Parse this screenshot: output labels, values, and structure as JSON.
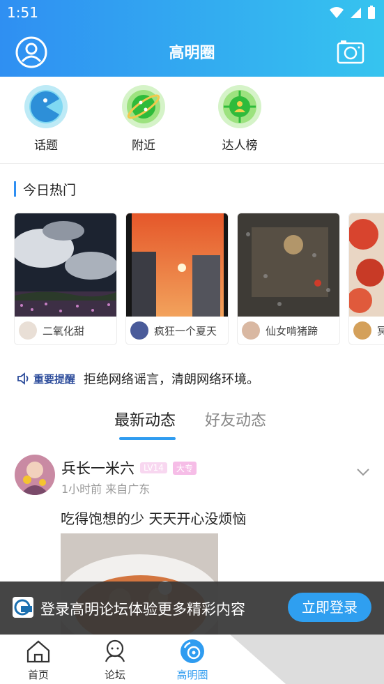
{
  "status_bar": {
    "time": "1:51"
  },
  "header": {
    "title": "高明圈",
    "profile_icon": "user-circle-icon",
    "camera_icon": "camera-icon"
  },
  "quick_entries": [
    {
      "label": "话题",
      "icon": "topic-icon",
      "color": "#7fd8f2"
    },
    {
      "label": "附近",
      "icon": "planet-icon",
      "color": "#9de27f"
    },
    {
      "label": "达人榜",
      "icon": "target-user-icon",
      "color": "#9de27f"
    }
  ],
  "hot_section": {
    "title": "今日热门"
  },
  "hot_cards": [
    {
      "name": "二氧化甜"
    },
    {
      "name": "疯狂一个夏天"
    },
    {
      "name": "仙女啃猪蹄"
    },
    {
      "name": "冥"
    }
  ],
  "notice": {
    "tag": "重要提醒",
    "text": "拒绝网络谣言，清朗网络环境。"
  },
  "feed_tabs": {
    "active": "最新动态",
    "inactive": "好友动态"
  },
  "post": {
    "username": "兵长一米六",
    "level": "LV14",
    "education": "大专",
    "meta": "1小时前  来自广东",
    "text": "吃得饱想的少 天天开心没烦恼"
  },
  "login_banner": {
    "text": "登录高明论坛体验更多精彩内容",
    "button": "立即登录"
  },
  "tabbar": [
    {
      "label": "首页",
      "icon": "home-icon",
      "active": false
    },
    {
      "label": "论坛",
      "icon": "forum-icon",
      "active": false
    },
    {
      "label": "高明圈",
      "icon": "circle-icon",
      "active": true
    }
  ],
  "colors": {
    "accent": "#2f9cf0",
    "header_start": "#2f8ff2",
    "header_end": "#36c4ef"
  }
}
